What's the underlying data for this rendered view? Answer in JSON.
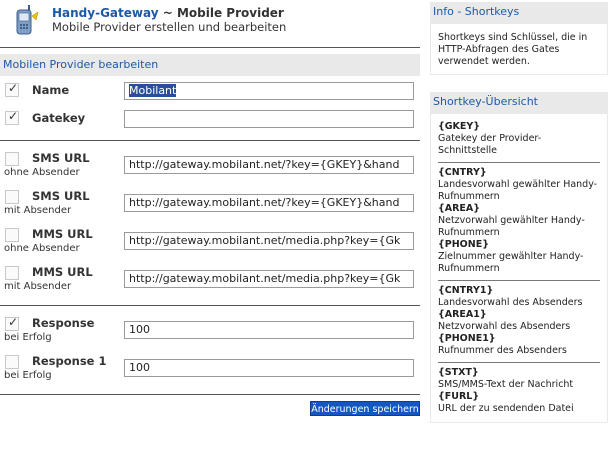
{
  "header": {
    "app_name": "Handy-Gateway",
    "separator": "~",
    "page_name": "Mobile Provider",
    "subtitle": "Mobile Provider erstellen und bearbeiten"
  },
  "form": {
    "section_title": "Mobilen Provider bearbeiten",
    "fields": [
      {
        "label": "Name",
        "sublabel": "",
        "checked": true,
        "value": "Mobilant",
        "selected": true
      },
      {
        "label": "Gatekey",
        "sublabel": "",
        "checked": true,
        "value": ""
      },
      {
        "label": "SMS URL",
        "sublabel": "ohne Absender",
        "checked": false,
        "value": "http://gateway.mobilant.net/?key={GKEY}&hand"
      },
      {
        "label": "SMS URL",
        "sublabel": "mit Absender",
        "checked": false,
        "value": "http://gateway.mobilant.net/?key={GKEY}&hand"
      },
      {
        "label": "MMS URL",
        "sublabel": "ohne Absender",
        "checked": false,
        "value": "http://gateway.mobilant.net/media.php?key={Gk"
      },
      {
        "label": "MMS URL",
        "sublabel": "mit Absender",
        "checked": false,
        "value": "http://gateway.mobilant.net/media.php?key={Gk"
      },
      {
        "label": "Response",
        "sublabel": "bei Erfolg",
        "checked": true,
        "value": "100"
      },
      {
        "label": "Response 1",
        "sublabel": "bei Erfolg",
        "checked": false,
        "value": "100"
      }
    ],
    "save_label": "Änderungen speichern"
  },
  "info": {
    "title": "Info - Shortkeys",
    "text": "Shortkeys sind Schlüssel, die in HTTP-Abfragen des Gates verwendet werden."
  },
  "overview": {
    "title": "Shortkey-Übersicht",
    "groups": [
      [
        {
          "key": "{GKEY}",
          "desc": "Gatekey der Provider-Schnittstelle"
        }
      ],
      [
        {
          "key": "{CNTRY}",
          "desc": "Landesvorwahl gewählter Handy-Rufnummern"
        },
        {
          "key": "{AREA}",
          "desc": "Netzvorwahl gewählter Handy-Rufnummern"
        },
        {
          "key": "{PHONE}",
          "desc": "Zielnummer gewählter Handy-Rufnummern"
        }
      ],
      [
        {
          "key": "{CNTRY1}",
          "desc": "Landesvorwahl des Absenders"
        },
        {
          "key": "{AREA1}",
          "desc": "Netzvorwahl des Absenders"
        },
        {
          "key": "{PHONE1}",
          "desc": "Rufnummer des Absenders"
        }
      ],
      [
        {
          "key": "{STXT}",
          "desc": "SMS/MMS-Text der Nachricht"
        },
        {
          "key": "{FURL}",
          "desc": "URL der zu sendenden Datei"
        }
      ]
    ]
  },
  "colors": {
    "link_blue": "#1a5aa8",
    "button_blue": "#1557c0",
    "panel_gray": "#e9e9e9"
  },
  "icons": {
    "logo": "phone-icon"
  }
}
